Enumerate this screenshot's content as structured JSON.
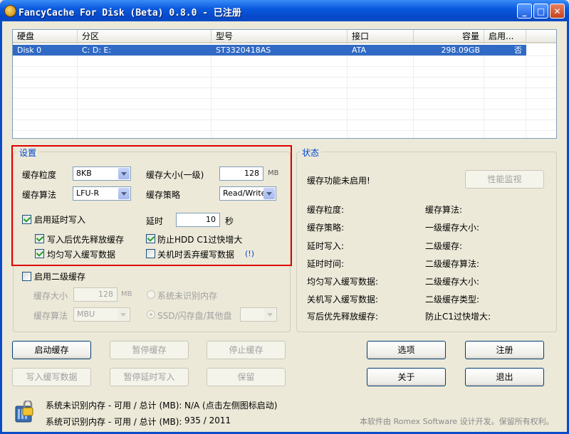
{
  "window": {
    "title": "FancyCache For Disk (Beta) 0.8.0 - 已注册"
  },
  "disk_list": {
    "columns": [
      "硬盘",
      "分区",
      "型号",
      "接口",
      "容量",
      "启用..."
    ],
    "rows": [
      {
        "disk": "Disk 0",
        "partition": "C: D: E:",
        "model": "ST3320418AS",
        "interface": "ATA",
        "capacity": "298.09GB",
        "enabled": "否"
      }
    ]
  },
  "settings": {
    "group_title": "设置",
    "cache_granularity_label": "缓存粒度",
    "cache_granularity_value": "8KB",
    "cache_size_label": "缓存大小(一级)",
    "cache_size_value": "128",
    "cache_size_unit": "MB",
    "cache_algorithm_label": "缓存算法",
    "cache_algorithm_value": "LFU-R",
    "cache_policy_label": "缓存策略",
    "cache_policy_value": "Read/Write",
    "deferred_write_label": "启用延时写入",
    "delay_label": "延时",
    "delay_value": "10",
    "delay_unit": "秒",
    "free_after_write_label": "写入后优先释放缓存",
    "prevent_hdd_c1_label": "防止HDD C1过快增大",
    "even_write_label": "均匀写入缓写数据",
    "discard_on_shutdown_label": "关机时丢弃缓写数据",
    "discard_info": "(!)",
    "l2_enable_label": "启用二级缓存",
    "l2_size_label": "缓存大小",
    "l2_size_value": "128",
    "l2_size_unit": "MB",
    "l2_algorithm_label": "缓存算法",
    "l2_algorithm_value": "MBU",
    "l2_unrecognized_mem_label": "系统未识别内存",
    "l2_ssd_label": "SSD/闪存盘/其他盘"
  },
  "status": {
    "group_title": "状态",
    "cache_disabled": "缓存功能未启用!",
    "perf_monitor_button": "性能监视",
    "fields_left": [
      "缓存粒度:",
      "缓存策略:",
      "延时写入:",
      "延时时间:",
      "均匀写入缓写数据:",
      "关机写入缓写数据:",
      "写后优先释放缓存:"
    ],
    "fields_right": [
      "缓存算法:",
      "一级缓存大小:",
      "二级缓存:",
      "二级缓存算法:",
      "二级缓存大小:",
      "二级缓存类型:",
      "防止C1过快增大:"
    ]
  },
  "buttons": {
    "start_cache": "启动缓存",
    "pause_cache": "暂停缓存",
    "stop_cache": "停止缓存",
    "write_deferred": "写入缓写数据",
    "pause_deferred": "暂停延时写入",
    "keep": "保留",
    "options": "选项",
    "register": "注册",
    "about": "关于",
    "exit": "退出"
  },
  "footer": {
    "unrecognized_mem_label": "系统未识别内存 - 可用 / 总计 (MB):",
    "unrecognized_mem_value": "N/A (点击左侧图标启动)",
    "recognized_mem_label": "系统可识别内存 - 可用 / 总计 (MB):",
    "recognized_mem_value": "935 / 2011",
    "copyright": "本软件由 Romex Software 设计开发。保留所有权利。"
  },
  "colors": {
    "highlight": "#E00000",
    "selection": "#316AC5",
    "group_title": "#0046D5"
  },
  "icons": [
    "app-icon",
    "minimize-icon",
    "maximize-icon",
    "close-icon",
    "memory-lock-icon"
  ]
}
